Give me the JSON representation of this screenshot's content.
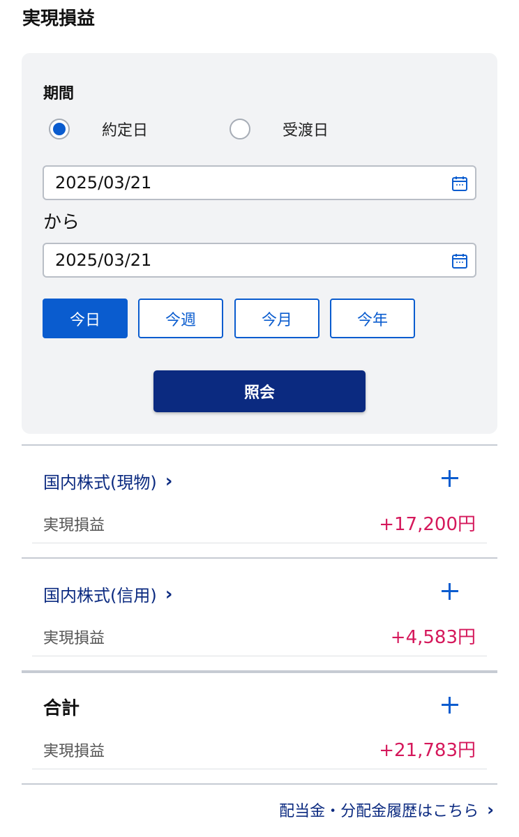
{
  "page": {
    "title": "実現損益"
  },
  "filter": {
    "period_label": "期間",
    "radio_options": [
      {
        "label": "約定日",
        "checked": true
      },
      {
        "label": "受渡日",
        "checked": false
      }
    ],
    "date_from": "2025/03/21",
    "separator": "から",
    "date_to": "2025/03/21",
    "quick_buttons": [
      {
        "label": "今日",
        "active": true
      },
      {
        "label": "今週",
        "active": false
      },
      {
        "label": "今月",
        "active": false
      },
      {
        "label": "今年",
        "active": false
      }
    ],
    "query_button": "照会"
  },
  "sections": [
    {
      "title": "国内株式(現物)",
      "row_label": "実現損益",
      "value": "+17,200円"
    },
    {
      "title": "国内株式(信用)",
      "row_label": "実現損益",
      "value": "+4,583円"
    }
  ],
  "total": {
    "title": "合計",
    "row_label": "実現損益",
    "value": "+21,783円"
  },
  "footer": {
    "link_text": "配当金・分配金履歴はこちら"
  },
  "colors": {
    "accent": "#0a5ccf",
    "navy": "#0b2a80",
    "positive": "#d5185b",
    "panel": "#f2f3f5"
  },
  "icons": {
    "calendar": "calendar-icon",
    "plus": "plus-icon",
    "chevron": "chevron-right-icon"
  }
}
